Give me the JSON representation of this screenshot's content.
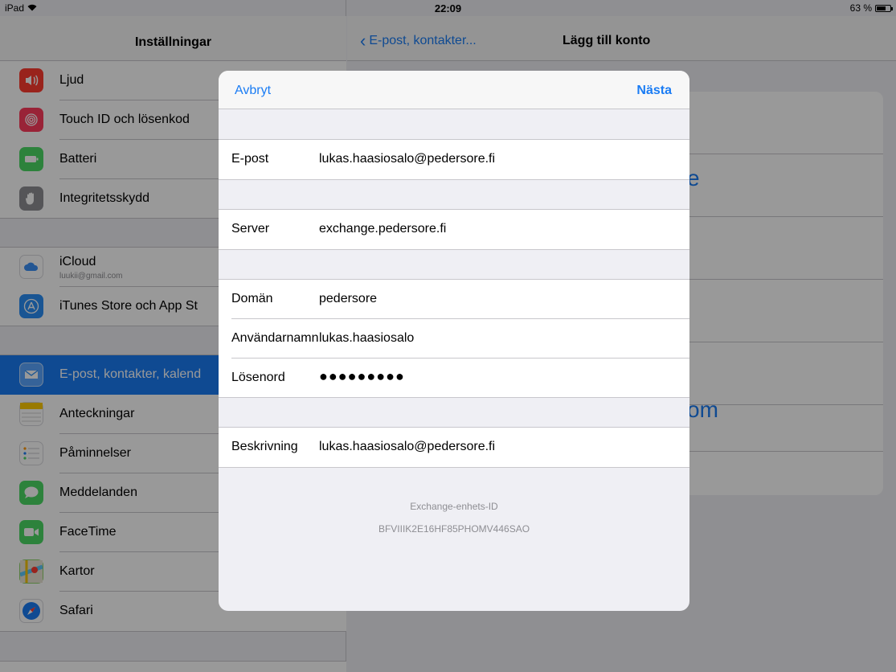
{
  "status_bar": {
    "device": "iPad",
    "time": "22:09",
    "battery": "63 %"
  },
  "master": {
    "title": "Inställningar",
    "items": [
      {
        "label": "Ljud",
        "color": "#ff3b30",
        "icon": "speaker-icon"
      },
      {
        "label": "Touch ID och lösenkod",
        "color": "#ff3b5c",
        "icon": "fingerprint-icon"
      },
      {
        "label": "Batteri",
        "color": "#4cd964",
        "icon": "battery-icon"
      },
      {
        "label": "Integritetsskydd",
        "color": "#8e8e93",
        "icon": "hand-icon"
      },
      {
        "label": "iCloud",
        "sub": "luukii@gmail.com",
        "color": "#ffffff",
        "icon": "cloud-icon"
      },
      {
        "label": "iTunes Store och App St",
        "color": "#2a8ef5",
        "icon": "app-store-icon"
      },
      {
        "label": "E-post, kontakter, kalend",
        "color": "#2a8ef5",
        "icon": "mail-icon"
      },
      {
        "label": "Anteckningar",
        "color": "#ffcc00",
        "icon": "notes-icon"
      },
      {
        "label": "Påminnelser",
        "color": "#ffffff",
        "icon": "reminders-icon"
      },
      {
        "label": "Meddelanden",
        "color": "#4cd964",
        "icon": "messages-icon"
      },
      {
        "label": "FaceTime",
        "color": "#4cd964",
        "icon": "video-camera-icon"
      },
      {
        "label": "Kartor",
        "color": "#5ac8fa",
        "icon": "maps-icon"
      },
      {
        "label": "Safari",
        "color": "#1a7cf4",
        "icon": "compass-icon"
      }
    ]
  },
  "detail": {
    "back_label": "E-post, kontakter...",
    "title": "Lägg till konto",
    "ghost_text_1": "e",
    "ghost_text_2": "om"
  },
  "sheet": {
    "cancel_label": "Avbryt",
    "next_label": "Nästa",
    "email": {
      "label": "E-post",
      "value": "lukas.haasiosalo@pedersore.fi"
    },
    "server": {
      "label": "Server",
      "value": "exchange.pedersore.fi"
    },
    "domain": {
      "label": "Domän",
      "value": "pedersore"
    },
    "username": {
      "label": "Användarnamn",
      "value": "lukas.haasiosalo"
    },
    "password": {
      "label": "Lösenord",
      "value": "●●●●●●●●●"
    },
    "description": {
      "label": "Beskrivning",
      "value": "lukas.haasiosalo@pedersore.fi"
    },
    "device_id_label": "Exchange-enhets-ID",
    "device_id_value": "BFVIIIK2E16HF85PHOMV446SAO"
  }
}
